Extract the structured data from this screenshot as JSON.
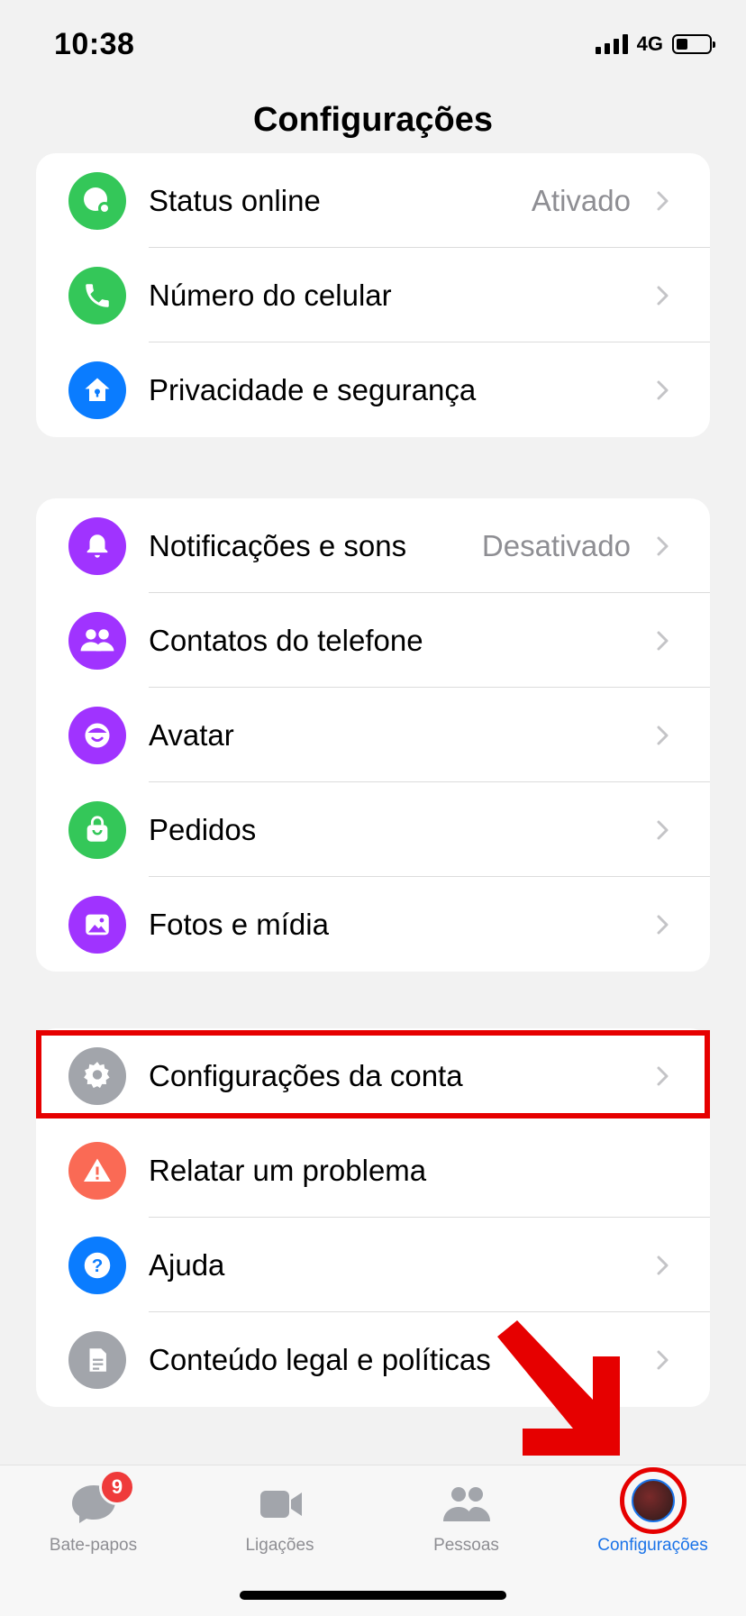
{
  "status_bar": {
    "time": "10:38",
    "network": "4G"
  },
  "header": {
    "title": "Configurações"
  },
  "group1": [
    {
      "label": "Status online",
      "value": "Ativado",
      "icon": "status-online-icon",
      "color": "#34c759"
    },
    {
      "label": "Número do celular",
      "value": "",
      "icon": "phone-icon",
      "color": "#34c759"
    },
    {
      "label": "Privacidade e segurança",
      "value": "",
      "icon": "privacy-home-lock-icon",
      "color": "#0a7cff"
    }
  ],
  "group2": [
    {
      "label": "Notificações e sons",
      "value": "Desativado",
      "icon": "bell-icon",
      "color": "#a033ff"
    },
    {
      "label": "Contatos do telefone",
      "value": "",
      "icon": "contacts-icon",
      "color": "#a033ff"
    },
    {
      "label": "Avatar",
      "value": "",
      "icon": "avatar-face-icon",
      "color": "#a033ff"
    },
    {
      "label": "Pedidos",
      "value": "",
      "icon": "shopping-bag-icon",
      "color": "#34c759"
    },
    {
      "label": "Fotos e mídia",
      "value": "",
      "icon": "photo-icon",
      "color": "#a033ff"
    }
  ],
  "group3": [
    {
      "label": "Configurações da conta",
      "value": "",
      "icon": "gear-icon",
      "color": "#a2a5ab"
    },
    {
      "label": "Relatar um problema",
      "value": "",
      "icon": "warning-icon",
      "color": "#fa6a55"
    },
    {
      "label": "Ajuda",
      "value": "",
      "icon": "help-icon",
      "color": "#0a7cff"
    },
    {
      "label": "Conteúdo legal e políticas",
      "value": "",
      "icon": "document-icon",
      "color": "#a2a5ab"
    }
  ],
  "tabbar": {
    "tabs": [
      {
        "label": "Bate-papos",
        "badge": "9",
        "icon": "chat-bubble-icon"
      },
      {
        "label": "Ligações",
        "icon": "video-camera-icon"
      },
      {
        "label": "Pessoas",
        "icon": "people-icon"
      },
      {
        "label": "Configurações",
        "icon": "profile-avatar-icon",
        "active": true
      }
    ]
  },
  "colors": {
    "accent": "#1a73e8",
    "highlight": "#e60000",
    "badge": "#ef3b3b"
  }
}
